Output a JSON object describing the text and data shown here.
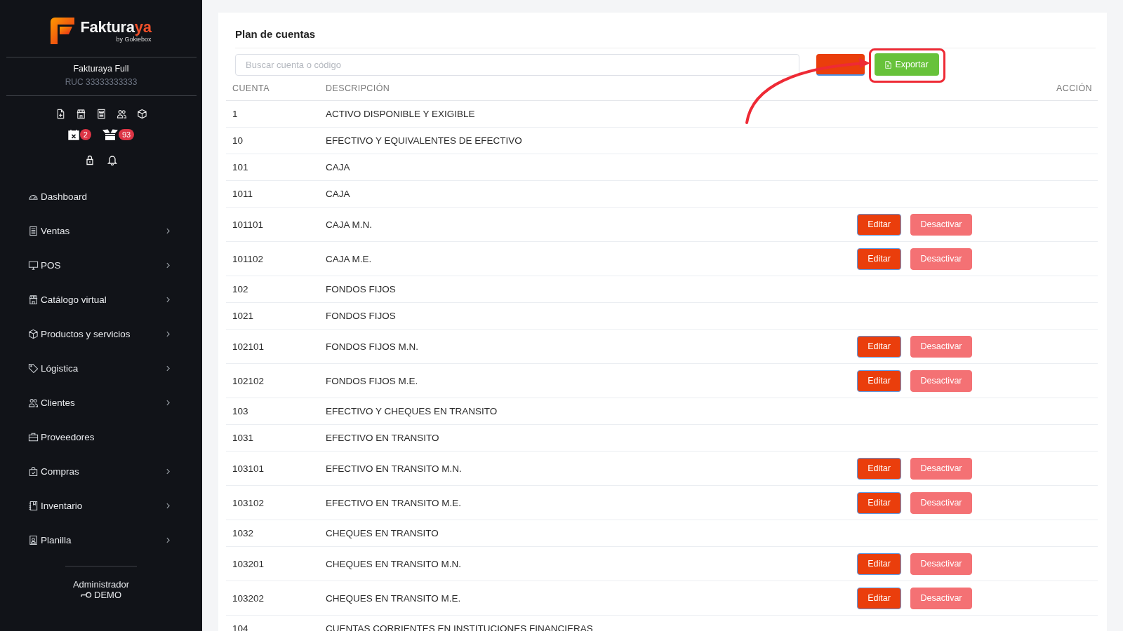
{
  "sidebar": {
    "brand": {
      "name": "Faktura",
      "accent": "ya",
      "tagline": "by Gokiebox"
    },
    "company": {
      "name": "Fakturaya Full",
      "ruc": "RUC 33333333333"
    },
    "counters": [
      {
        "count": "2"
      },
      {
        "count": "93"
      }
    ],
    "menu": [
      {
        "label": "Dashboard",
        "has_submenu": false
      },
      {
        "label": "Ventas",
        "has_submenu": true
      },
      {
        "label": "POS",
        "has_submenu": true
      },
      {
        "label": "Catálogo virtual",
        "has_submenu": true
      },
      {
        "label": "Productos y servicios",
        "has_submenu": true
      },
      {
        "label": "Lógistica",
        "has_submenu": true
      },
      {
        "label": "Clientes",
        "has_submenu": true
      },
      {
        "label": "Proveedores",
        "has_submenu": false
      },
      {
        "label": "Compras",
        "has_submenu": true
      },
      {
        "label": "Inventario",
        "has_submenu": true
      },
      {
        "label": "Planilla",
        "has_submenu": true
      }
    ],
    "user": {
      "role": "Administrador",
      "name": "DEMO"
    }
  },
  "page": {
    "title": "Plan de cuentas",
    "search": {
      "placeholder": "Buscar cuenta o código"
    },
    "buttons": [
      {
        "kind": "primary"
      },
      {
        "kind": "export",
        "label": "Exportar"
      }
    ],
    "table": {
      "columns": [
        "CUENTA",
        "DESCRIPCIÓN",
        "ACCIÓN"
      ],
      "rows": [
        {
          "code": "1",
          "description": "ACTIVO DISPONIBLE Y EXIGIBLE"
        },
        {
          "code": "10",
          "description": "EFECTIVO Y EQUIVALENTES DE EFECTIVO"
        },
        {
          "code": "101",
          "description": "CAJA"
        },
        {
          "code": "1011",
          "description": "CAJA"
        },
        {
          "code": "101101",
          "description": "CAJA M.N.",
          "actions": [
            {
              "kind": "edit",
              "label": "Editar"
            },
            {
              "kind": "deactivate",
              "label": "Desactivar"
            }
          ]
        },
        {
          "code": "101102",
          "description": "CAJA M.E.",
          "actions": [
            {
              "kind": "edit",
              "label": "Editar"
            },
            {
              "kind": "deactivate",
              "label": "Desactivar"
            }
          ]
        },
        {
          "code": "102",
          "description": "FONDOS FIJOS"
        },
        {
          "code": "1021",
          "description": "FONDOS FIJOS"
        },
        {
          "code": "102101",
          "description": "FONDOS FIJOS M.N.",
          "actions": [
            {
              "kind": "edit",
              "label": "Editar"
            },
            {
              "kind": "deactivate",
              "label": "Desactivar"
            }
          ]
        },
        {
          "code": "102102",
          "description": "FONDOS FIJOS M.E.",
          "actions": [
            {
              "kind": "edit",
              "label": "Editar"
            },
            {
              "kind": "deactivate",
              "label": "Desactivar"
            }
          ]
        },
        {
          "code": "103",
          "description": "EFECTIVO Y CHEQUES EN TRANSITO"
        },
        {
          "code": "1031",
          "description": "EFECTIVO EN TRANSITO"
        },
        {
          "code": "103101",
          "description": "EFECTIVO EN TRANSITO M.N.",
          "actions": [
            {
              "kind": "edit",
              "label": "Editar"
            },
            {
              "kind": "deactivate",
              "label": "Desactivar"
            }
          ]
        },
        {
          "code": "103102",
          "description": "EFECTIVO EN TRANSITO M.E.",
          "actions": [
            {
              "kind": "edit",
              "label": "Editar"
            },
            {
              "kind": "deactivate",
              "label": "Desactivar"
            }
          ]
        },
        {
          "code": "1032",
          "description": "CHEQUES EN TRANSITO"
        },
        {
          "code": "103201",
          "description": "CHEQUES EN TRANSITO M.N.",
          "actions": [
            {
              "kind": "edit",
              "label": "Editar"
            },
            {
              "kind": "deactivate",
              "label": "Desactivar"
            }
          ]
        },
        {
          "code": "103202",
          "description": "CHEQUES EN TRANSITO M.E.",
          "actions": [
            {
              "kind": "edit",
              "label": "Editar"
            },
            {
              "kind": "deactivate",
              "label": "Desactivar"
            }
          ]
        },
        {
          "code": "104",
          "description": "CUENTAS CORRIENTES EN INSTITUCIONES FINANCIERAS"
        }
      ]
    }
  },
  "annotation": {
    "arrow": true,
    "frame": true
  }
}
